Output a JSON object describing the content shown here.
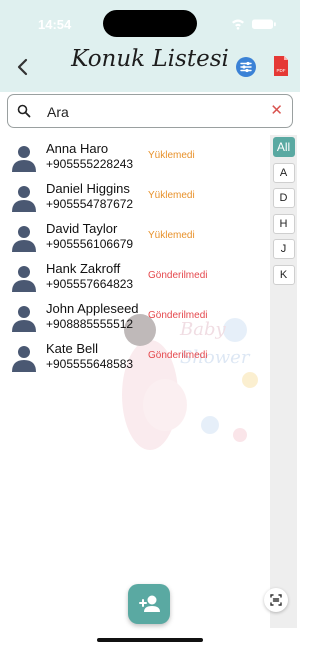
{
  "status_bar": {
    "time": "14:54"
  },
  "header": {
    "title": "Konuk Listesi",
    "icons": {
      "back": "chevron-left-icon",
      "filter": "sliders-icon",
      "pdf": "pdf-icon"
    },
    "accent_color": "#dff0ef"
  },
  "search": {
    "placeholder": "Ara",
    "value": ""
  },
  "contacts": [
    {
      "name": "Anna Haro",
      "phone": "+905555228243",
      "status": "Yüklemedi",
      "status_color": "#e8912a"
    },
    {
      "name": "Daniel Higgins",
      "phone": "+905554787672",
      "status": "Yüklemedi",
      "status_color": "#e8912a"
    },
    {
      "name": "David Taylor",
      "phone": "+905556106679",
      "status": "Yüklemedi",
      "status_color": "#e8912a"
    },
    {
      "name": "Hank Zakroff",
      "phone": "+905557664823",
      "status": "Gönderilmedi",
      "status_color": "#e5484d"
    },
    {
      "name": "John Appleseed",
      "phone": "+908885555512",
      "status": "Gönderilmedi",
      "status_color": "#e5484d"
    },
    {
      "name": "Kate Bell",
      "phone": "+905555648583",
      "status": "Gönderilmedi",
      "status_color": "#e5484d"
    }
  ],
  "index_bar": {
    "items": [
      "All",
      "A",
      "D",
      "H",
      "J",
      "K"
    ],
    "active": "All",
    "active_color": "#5aa9a2"
  },
  "watermark": {
    "line1": "Baby",
    "line2": "Shower"
  },
  "fab": {
    "icon": "add-person-icon",
    "color": "#5aa9a2"
  },
  "scan_button": {
    "icon": "scan-icon"
  }
}
